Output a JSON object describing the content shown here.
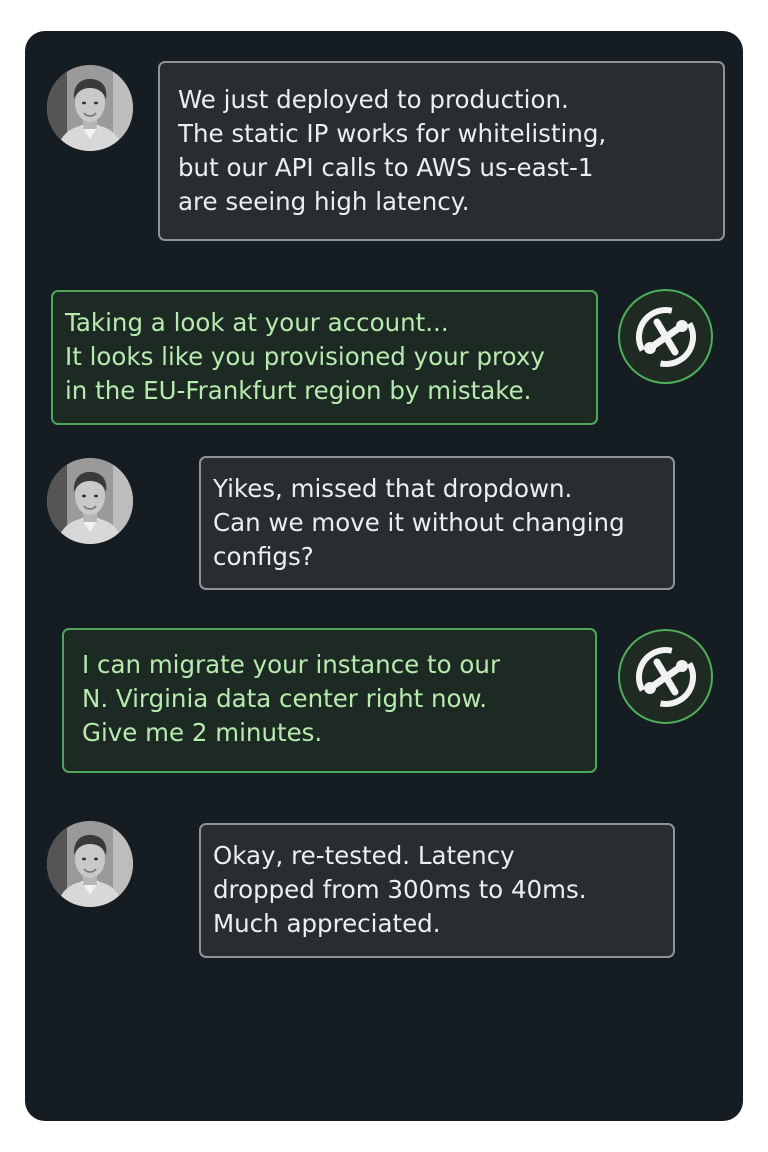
{
  "conversation": {
    "messages": [
      {
        "sender": "user",
        "avatar": "user-photo",
        "text": "We just deployed to production.\nThe static IP works for whitelisting,\nbut our API calls to AWS us-east-1\nare seeing high latency."
      },
      {
        "sender": "support",
        "avatar": "support-logo-icon",
        "text": "Taking a look at your account...\nIt looks like you provisioned your proxy\nin the EU-Frankfurt region by mistake."
      },
      {
        "sender": "user",
        "avatar": "user-photo",
        "text": "Yikes, missed that dropdown.\nCan we move it without changing\nconfigs?"
      },
      {
        "sender": "support",
        "avatar": "support-logo-icon",
        "text": "I can migrate your instance to our\nN. Virginia data center right now.\nGive me 2 minutes."
      },
      {
        "sender": "user",
        "avatar": "user-photo",
        "text": "Okay, re-tested. Latency\ndropped from 300ms to 40ms.\nMuch appreciated."
      }
    ]
  },
  "colors": {
    "panel_background": "#161d22",
    "user_bubble": "#272d31",
    "user_border": "#8d9397",
    "user_text": "#eceeef",
    "support_bubble": "#1d2a24",
    "support_border": "#4ea65a",
    "support_text": "#b7eaae"
  }
}
